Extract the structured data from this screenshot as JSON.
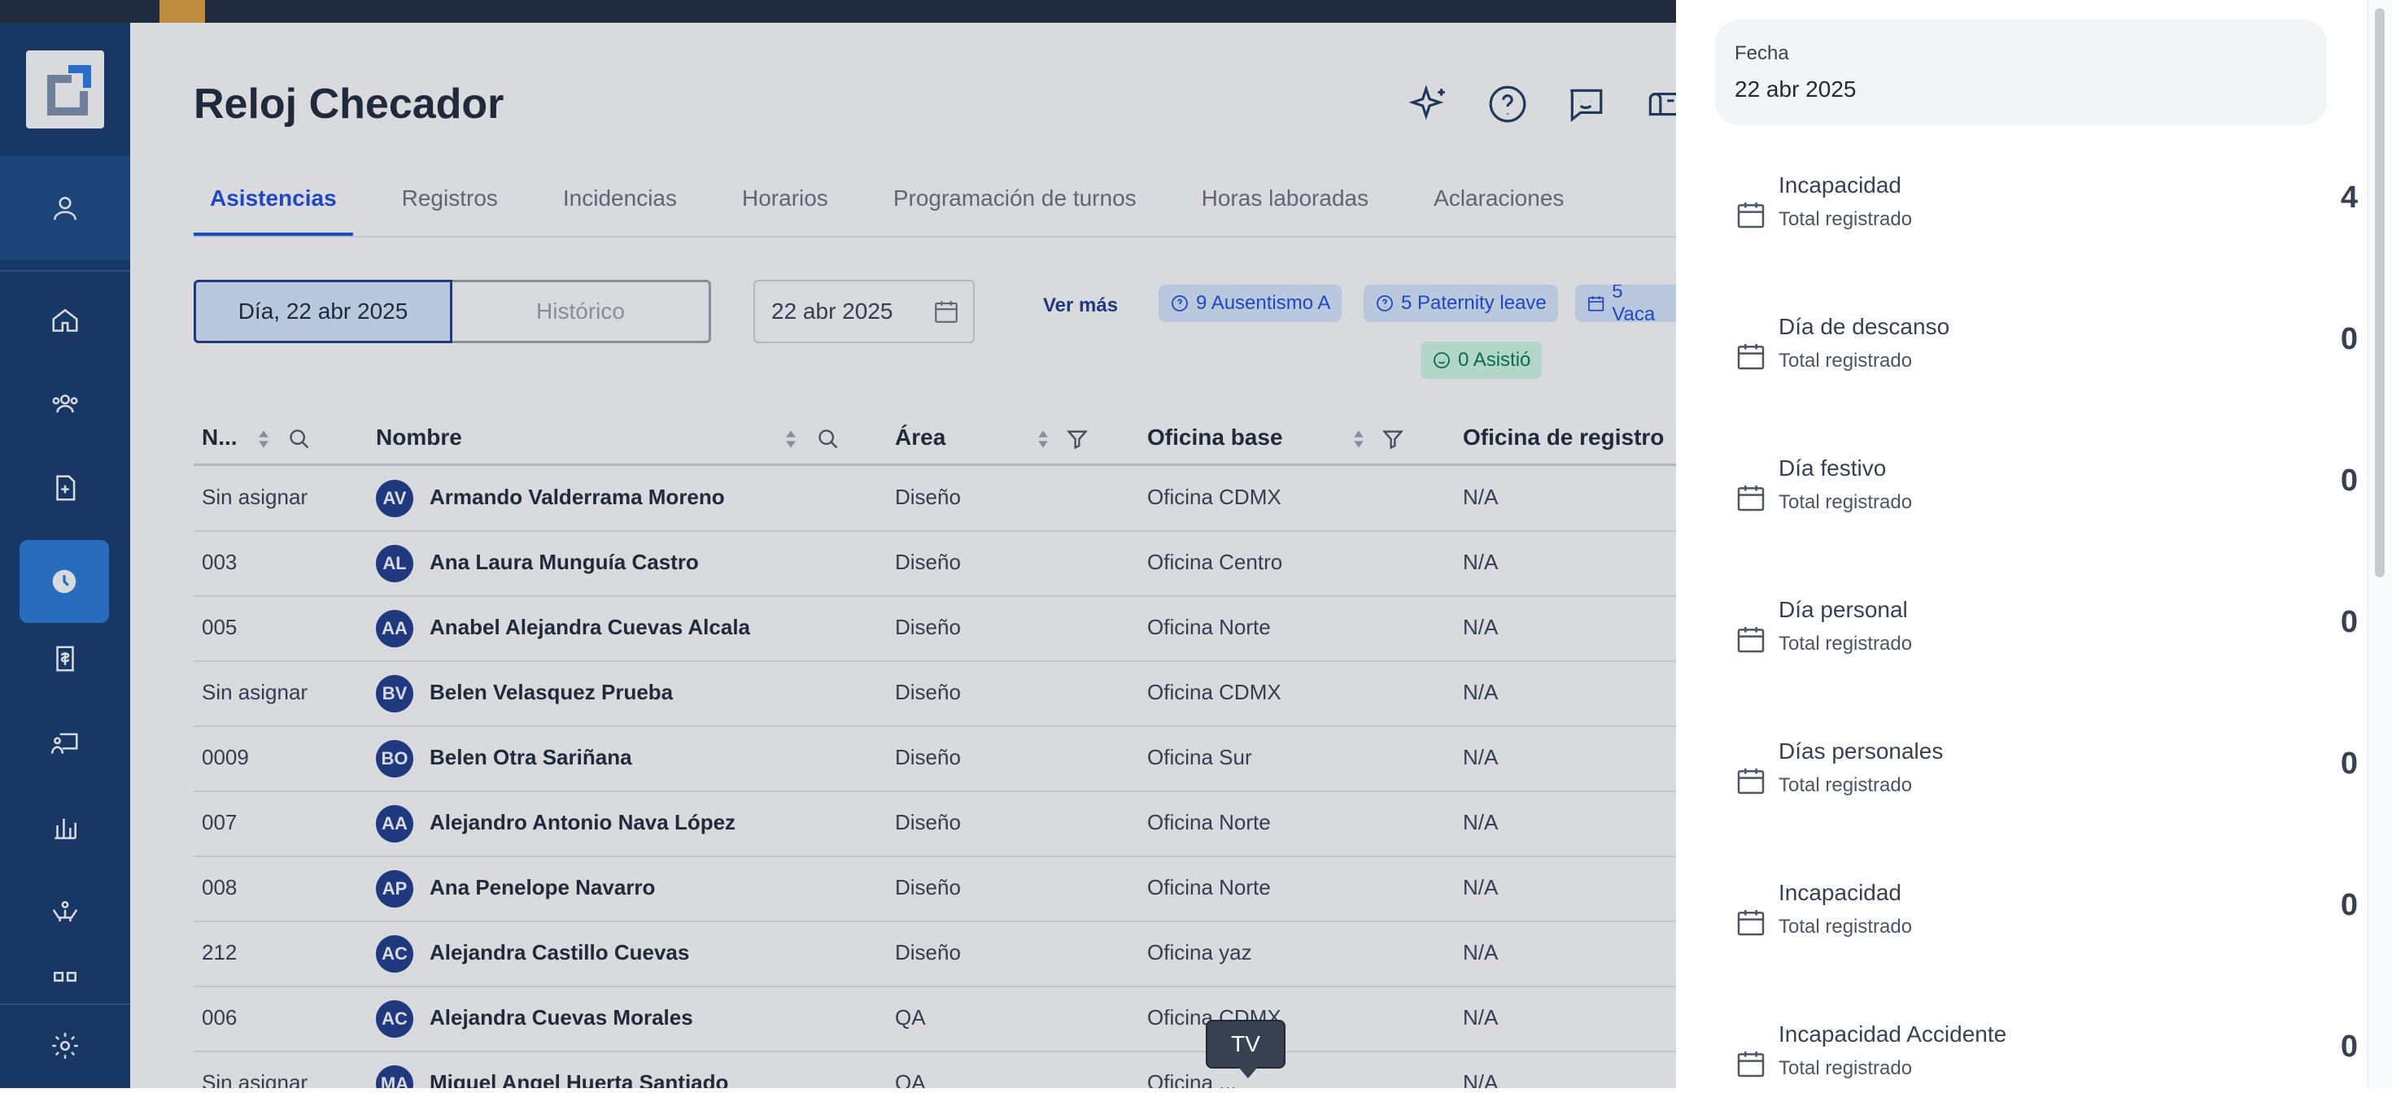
{
  "page": {
    "title": "Reloj Checador"
  },
  "header_icons": [
    "sparkles-icon",
    "help-icon",
    "feedback-icon",
    "mailbox-icon"
  ],
  "tabs": [
    {
      "label": "Asistencias",
      "active": true
    },
    {
      "label": "Registros"
    },
    {
      "label": "Incidencias"
    },
    {
      "label": "Horarios"
    },
    {
      "label": "Programación de turnos"
    },
    {
      "label": "Horas laboradas"
    },
    {
      "label": "Aclaraciones"
    }
  ],
  "view_toggle": {
    "day_label": "Día, 22 abr 2025",
    "history_label": "Histórico"
  },
  "date_input": {
    "value": "22 abr 2025"
  },
  "filters": {
    "ver_mas": "Ver más",
    "chips": [
      {
        "label": "9 Ausentismo A",
        "icon": "question-circle-icon",
        "color": "blue"
      },
      {
        "label": "5 Paternity leave",
        "icon": "question-circle-icon",
        "color": "blue"
      },
      {
        "label": "5 Vaca",
        "icon": "calendar-icon",
        "color": "blue"
      },
      {
        "label": "0 Asistió",
        "icon": "smile-icon",
        "color": "green"
      }
    ]
  },
  "table": {
    "columns": [
      "N...",
      "Nombre",
      "Área",
      "Oficina base",
      "Oficina de registro"
    ],
    "rows": [
      {
        "num": "Sin asignar",
        "initials": "AV",
        "name": "Armando Valderrama Moreno",
        "area": "Diseño",
        "office": "Oficina CDMX",
        "reg_office": "N/A"
      },
      {
        "num": "003",
        "initials": "AL",
        "name": "Ana Laura Munguía Castro",
        "area": "Diseño",
        "office": "Oficina Centro",
        "reg_office": "N/A"
      },
      {
        "num": "005",
        "initials": "AA",
        "name": "Anabel Alejandra Cuevas Alcala",
        "area": "Diseño",
        "office": "Oficina Norte",
        "reg_office": "N/A"
      },
      {
        "num": "Sin asignar",
        "initials": "BV",
        "name": "Belen Velasquez Prueba",
        "area": "Diseño",
        "office": "Oficina CDMX",
        "reg_office": "N/A"
      },
      {
        "num": "0009",
        "initials": "BO",
        "name": "Belen Otra Sariñana",
        "area": "Diseño",
        "office": "Oficina Sur",
        "reg_office": "N/A"
      },
      {
        "num": "007",
        "initials": "AA",
        "name": "Alejandro Antonio Nava López",
        "area": "Diseño",
        "office": "Oficina Norte",
        "reg_office": "N/A"
      },
      {
        "num": "008",
        "initials": "AP",
        "name": "Ana Penelope Navarro",
        "area": "Diseño",
        "office": "Oficina Norte",
        "reg_office": "N/A"
      },
      {
        "num": "212",
        "initials": "AC",
        "name": "Alejandra Castillo Cuevas",
        "area": "Diseño",
        "office": "Oficina yaz",
        "reg_office": "N/A"
      },
      {
        "num": "006",
        "initials": "AC",
        "name": "Alejandra Cuevas Morales",
        "area": "QA",
        "office": "Oficina CDMX",
        "reg_office": "N/A"
      },
      {
        "num": "Sin asignar",
        "initials": "MA",
        "name": "Miguel Angel Huerta Santiado",
        "area": "QA",
        "office": "Oficina ...",
        "reg_office": "N/A"
      }
    ]
  },
  "tooltip": {
    "text": "TV"
  },
  "panel": {
    "fecha_label": "Fecha",
    "fecha_value": "22 abr 2025",
    "stats": [
      {
        "title": "Incapacidad",
        "subtitle": "Total registrado",
        "count": "4"
      },
      {
        "title": "Día de descanso",
        "subtitle": "Total registrado",
        "count": "0"
      },
      {
        "title": "Día festivo",
        "subtitle": "Total registrado",
        "count": "0"
      },
      {
        "title": "Día personal",
        "subtitle": "Total registrado",
        "count": "0"
      },
      {
        "title": "Días personales",
        "subtitle": "Total registrado",
        "count": "0"
      },
      {
        "title": "Incapacidad",
        "subtitle": "Total registrado",
        "count": "0"
      },
      {
        "title": "Incapacidad Accidente",
        "subtitle": "Total registrado",
        "count": "0"
      }
    ]
  },
  "colors": {
    "sidebar": "#16396b",
    "accent": "#1d4ed8",
    "active_nav": "#2979d8"
  }
}
